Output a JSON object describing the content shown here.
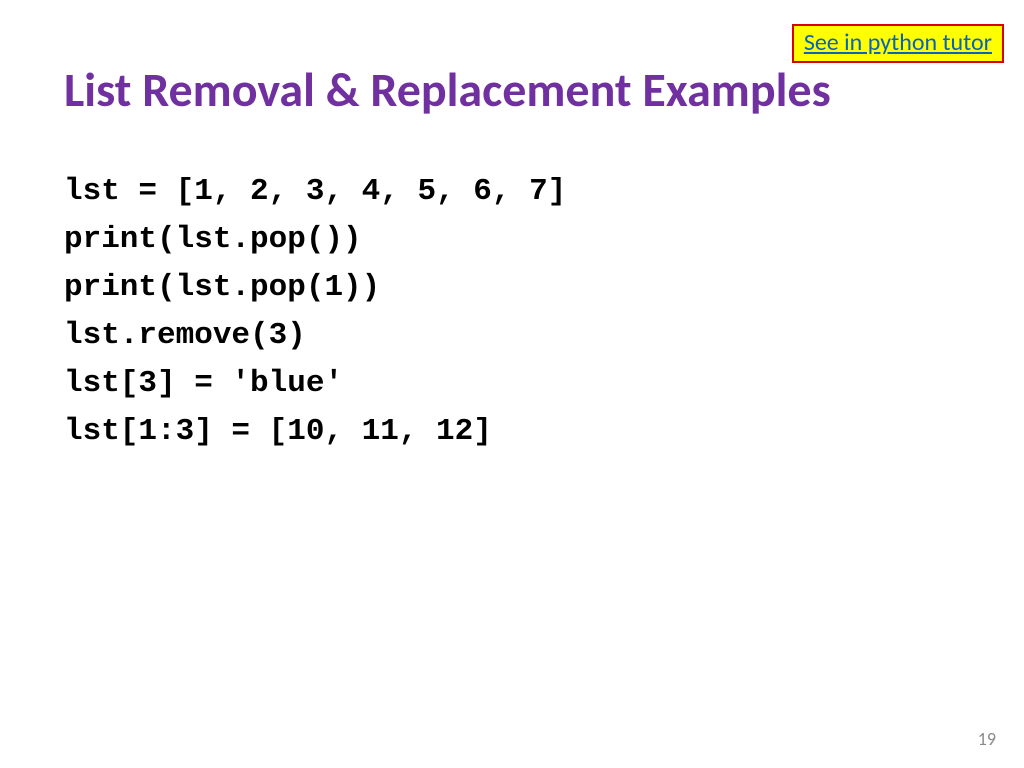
{
  "link": {
    "label": "See in python tutor"
  },
  "title": "List Removal & Replacement Examples",
  "code": {
    "line1": "lst = [1, 2, 3, 4, 5, 6, 7]",
    "line2": "print(lst.pop())",
    "line3": "print(lst.pop(1))",
    "line4": "lst.remove(3)",
    "line5": "lst[3] = 'blue'",
    "line6": "lst[1:3] = [10, 11, 12]"
  },
  "page_number": "19"
}
